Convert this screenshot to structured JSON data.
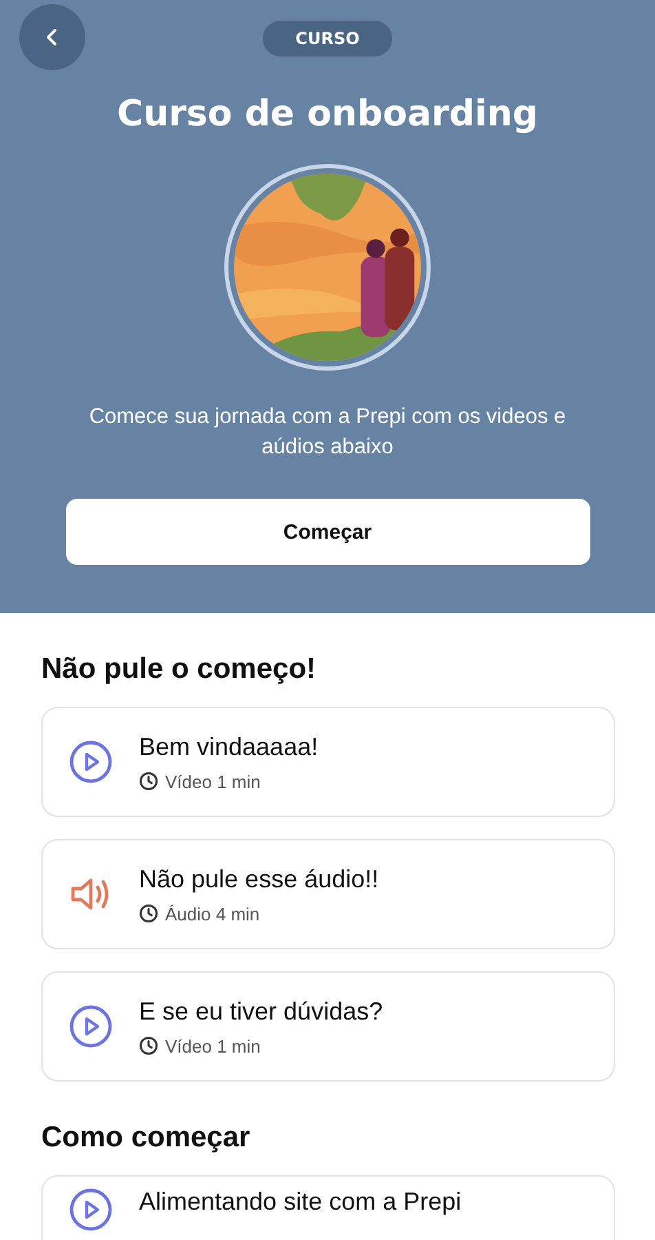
{
  "header": {
    "badge": "CURSO",
    "title": "Curso de onboarding",
    "description": "Comece sua jornada com a Prepi com os videos e aúdios abaixo",
    "button": "Começar"
  },
  "sections": [
    {
      "title": "Não pule o começo!",
      "lessons": [
        {
          "kind": "video",
          "title": "Bem vindaaaaa!",
          "meta": "Vídeo 1 min"
        },
        {
          "kind": "audio",
          "title": "Não pule esse áudio!!",
          "meta": "Áudio 4 min"
        },
        {
          "kind": "video",
          "title": "E se eu tiver dúvidas?",
          "meta": "Vídeo 1 min"
        }
      ]
    },
    {
      "title": "Como começar",
      "lessons": [
        {
          "kind": "video",
          "title": "Alimentando site com a Prepi"
        }
      ]
    }
  ]
}
